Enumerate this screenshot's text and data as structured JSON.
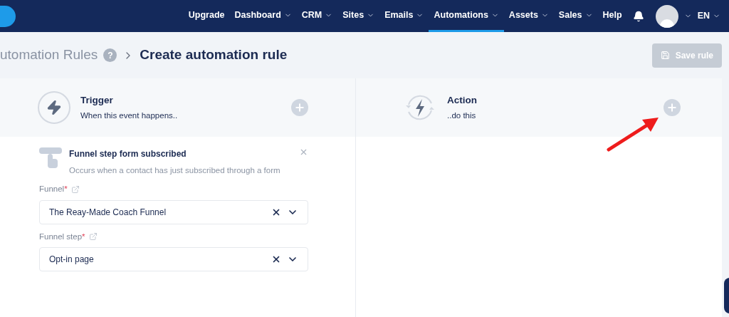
{
  "nav": {
    "items": [
      {
        "label": "Upgrade",
        "dropdown": false,
        "selected": false
      },
      {
        "label": "Dashboard",
        "dropdown": true,
        "selected": false
      },
      {
        "label": "CRM",
        "dropdown": true,
        "selected": false
      },
      {
        "label": "Sites",
        "dropdown": true,
        "selected": false
      },
      {
        "label": "Emails",
        "dropdown": true,
        "selected": false
      },
      {
        "label": "Automations",
        "dropdown": true,
        "selected": true
      },
      {
        "label": "Assets",
        "dropdown": true,
        "selected": false
      },
      {
        "label": "Sales",
        "dropdown": true,
        "selected": false
      },
      {
        "label": "Help",
        "dropdown": false,
        "selected": false
      }
    ],
    "language": "EN"
  },
  "breadcrumb": {
    "parent": "utomation Rules",
    "help": "?",
    "current": "Create automation rule"
  },
  "save_button": {
    "label": "Save rule",
    "disabled": true
  },
  "trigger": {
    "title": "Trigger",
    "subtitle": "When this event happens..",
    "event": {
      "title": "Funnel step form subscribed",
      "description": "Occurs when a contact has just subscribed through a form"
    },
    "fields": [
      {
        "label": "Funnel",
        "required_mark": "*",
        "value": "The Reay-Made Coach Funnel"
      },
      {
        "label": "Funnel step",
        "required_mark": "*",
        "value": "Opt-in page"
      }
    ]
  },
  "action": {
    "title": "Action",
    "subtitle": "..do this"
  }
}
